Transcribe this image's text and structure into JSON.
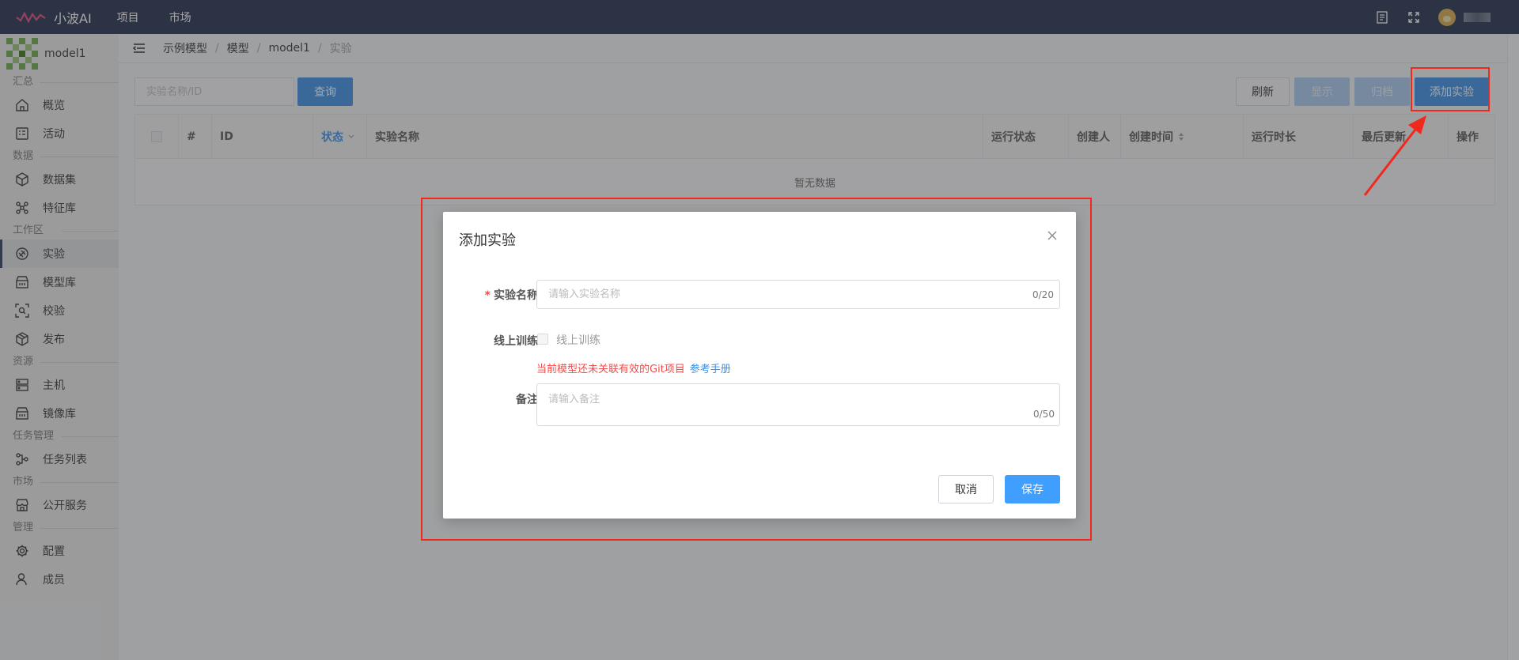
{
  "topbar": {
    "app_name": "小波AI",
    "nav": [
      "项目",
      "市场"
    ],
    "icons": [
      "document-icon",
      "fullscreen-icon",
      "avatar"
    ]
  },
  "sidebar": {
    "model_name": "model1",
    "groups": [
      {
        "label": "汇总",
        "items": [
          {
            "label": "概览",
            "icon": "home-icon"
          },
          {
            "label": "活动",
            "icon": "activity-icon"
          }
        ]
      },
      {
        "label": "数据",
        "items": [
          {
            "label": "数据集",
            "icon": "cube-icon"
          },
          {
            "label": "特征库",
            "icon": "feature-icon"
          }
        ]
      },
      {
        "label": "工作区",
        "items": [
          {
            "label": "实验",
            "icon": "experiment-icon",
            "active": true
          },
          {
            "label": "模型库",
            "icon": "model-store-icon"
          },
          {
            "label": "校验",
            "icon": "scan-icon"
          },
          {
            "label": "发布",
            "icon": "package-icon"
          }
        ]
      },
      {
        "label": "资源",
        "items": [
          {
            "label": "主机",
            "icon": "server-icon"
          },
          {
            "label": "镜像库",
            "icon": "image-store-icon"
          }
        ]
      },
      {
        "label": "任务管理",
        "items": [
          {
            "label": "任务列表",
            "icon": "workflow-icon"
          }
        ]
      },
      {
        "label": "市场",
        "items": [
          {
            "label": "公开服务",
            "icon": "store-icon"
          }
        ]
      },
      {
        "label": "管理",
        "items": [
          {
            "label": "配置",
            "icon": "gear-icon"
          },
          {
            "label": "成员",
            "icon": "user-icon"
          }
        ]
      }
    ]
  },
  "breadcrumb": [
    "示例模型",
    "模型",
    "model1",
    "实验"
  ],
  "toolbar": {
    "search_placeholder": "实验名称/ID",
    "query_label": "查询",
    "refresh_label": "刷新",
    "show_label": "显示",
    "archive_label": "归档",
    "add_label": "添加实验"
  },
  "table": {
    "columns": [
      "#",
      "ID",
      "状态",
      "实验名称",
      "运行状态",
      "创建人",
      "创建时间",
      "运行时长",
      "最后更新",
      "操作"
    ],
    "empty_text": "暂无数据"
  },
  "modal": {
    "title": "添加实验",
    "name_label": "实验名称",
    "name_placeholder": "请输入实验名称",
    "name_counter": "0/20",
    "online_label": "线上训练",
    "online_checkbox_label": "线上训练",
    "warning_text": "当前模型还未关联有效的Git项目",
    "reference_link": "参考手册",
    "remark_label": "备注",
    "remark_placeholder": "请输入备注",
    "remark_counter": "0/50",
    "cancel_label": "取消",
    "save_label": "保存"
  },
  "colors": {
    "topbar_bg": "#1f2d4b",
    "primary": "#3a8ee6",
    "annotation_red": "#f0281e",
    "warning_red": "#f04b4b"
  }
}
